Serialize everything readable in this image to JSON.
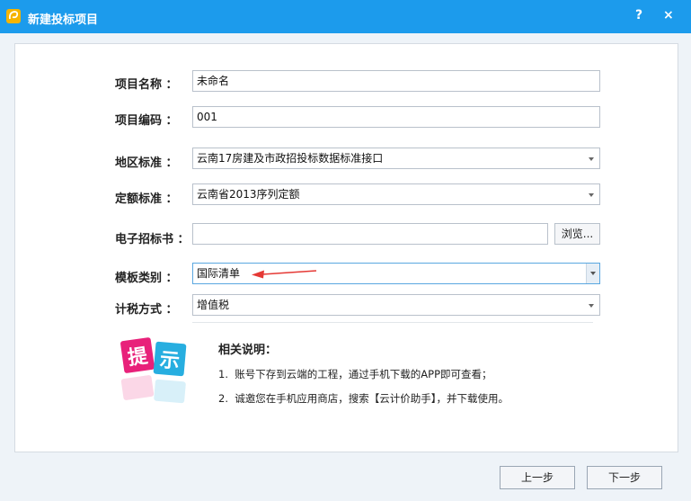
{
  "window": {
    "title": "新建投标项目",
    "help_label": "?",
    "close_label": "×",
    "accent_color": "#1c9bec",
    "app_icon": "app-logo-icon"
  },
  "form": {
    "project_name": {
      "label": "项目名称 ：",
      "value": "未命名"
    },
    "project_code": {
      "label": "项目编码 ：",
      "value": "001"
    },
    "region_standard": {
      "label": "地区标准 ：",
      "value": "云南17房建及市政招投标数据标准接口"
    },
    "quota_standard": {
      "label": "定额标准 ：",
      "value": "云南省2013序列定额"
    },
    "tender_document": {
      "label": "电子招标书 ：",
      "value": "",
      "browse_label": "浏览..."
    },
    "template_type": {
      "label": "模板类别 ：",
      "value": "国际清单"
    },
    "tax_method": {
      "label": "计税方式 ：",
      "value": "增值税"
    }
  },
  "hint": {
    "logo_text_1": "提",
    "logo_text_2": "示",
    "title": "相关说明：",
    "lines": [
      "1.  账号下存到云端的工程，通过手机下载的APP即可查看；",
      "2.  诚邀您在手机应用商店，搜索【云计价助手】，并下载使用。"
    ]
  },
  "footer": {
    "prev_label": "上一步",
    "next_label": "下一步"
  }
}
